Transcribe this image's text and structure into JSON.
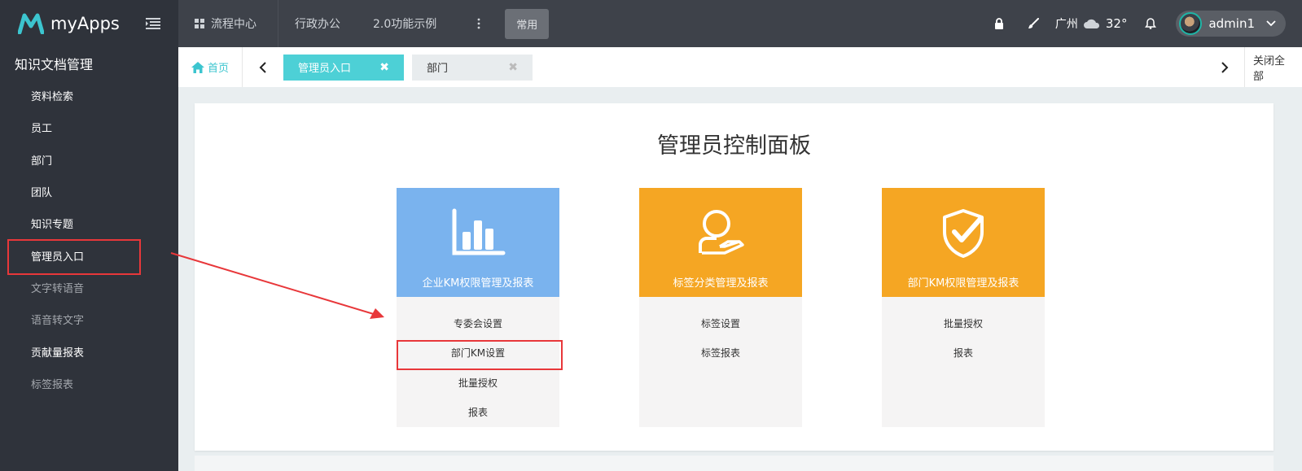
{
  "brand": {
    "name": "myApps"
  },
  "topnav": {
    "items": [
      "流程中心",
      "行政办公",
      "2.0功能示例"
    ],
    "common_button": "常用"
  },
  "topright": {
    "city": "广州",
    "temperature": "32°",
    "username": "admin1"
  },
  "sidebar": {
    "title": "知识文档管理",
    "items": [
      {
        "label": "资料检索"
      },
      {
        "label": "员工"
      },
      {
        "label": "部门"
      },
      {
        "label": "团队"
      },
      {
        "label": "知识专题"
      },
      {
        "label": "管理员入口"
      },
      {
        "label": "文字转语音"
      },
      {
        "label": "语音转文字"
      },
      {
        "label": "贡献量报表"
      },
      {
        "label": "标签报表"
      }
    ]
  },
  "tabs": {
    "home": "首页",
    "open": [
      "管理员入口",
      "部门"
    ],
    "close_all": "关闭全部"
  },
  "main": {
    "title": "管理员控制面板",
    "cards": [
      {
        "title": "企业KM权限管理及报表",
        "icon": "bar-chart-icon",
        "color": "#7ab3ee",
        "links": [
          "专委会设置",
          "部门KM设置",
          "批量授权",
          "报表"
        ]
      },
      {
        "title": "标签分类管理及报表",
        "icon": "user-hand-icon",
        "color": "#f5a623",
        "links": [
          "标签设置",
          "标签报表"
        ]
      },
      {
        "title": "部门KM权限管理及报表",
        "icon": "shield-check-icon",
        "color": "#f5a623",
        "links": [
          "批量授权",
          "报表"
        ]
      }
    ]
  }
}
